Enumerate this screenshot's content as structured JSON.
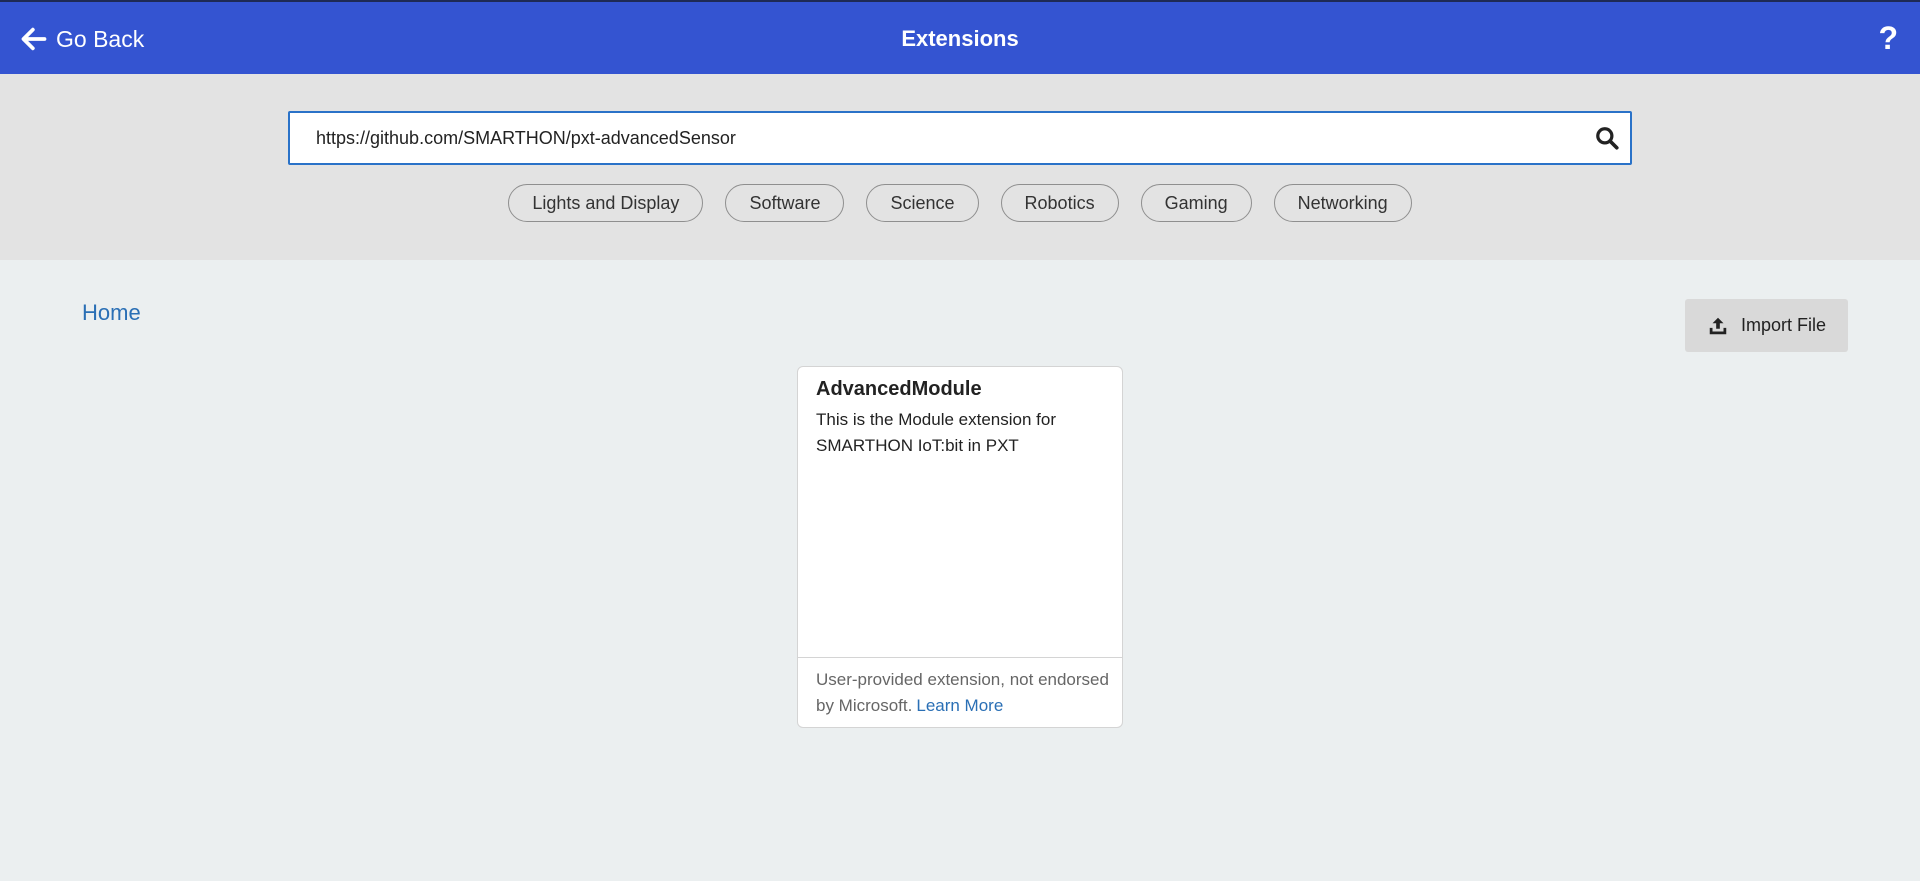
{
  "header": {
    "back_label": "Go Back",
    "title": "Extensions",
    "help_symbol": "?"
  },
  "search": {
    "value": "https://github.com/SMARTHON/pxt-advancedSensor",
    "icon": "search-icon"
  },
  "tags": [
    {
      "label": "Lights and Display"
    },
    {
      "label": "Software"
    },
    {
      "label": "Science"
    },
    {
      "label": "Robotics"
    },
    {
      "label": "Gaming"
    },
    {
      "label": "Networking"
    }
  ],
  "breadcrumb": {
    "home_label": "Home"
  },
  "import": {
    "label": "Import File",
    "icon": "upload-icon"
  },
  "card": {
    "title": "AdvancedModule",
    "description": "This is the Module extension for SMARTHON IoT:bit in PXT",
    "footer_text": "User-provided extension, not endorsed by Microsoft.",
    "learn_more_label": "Learn More"
  },
  "colors": {
    "header_bg": "#3454d1",
    "search_band_bg": "#e3e3e3",
    "page_bg": "#ebeff0",
    "link": "#2a6fb5"
  }
}
